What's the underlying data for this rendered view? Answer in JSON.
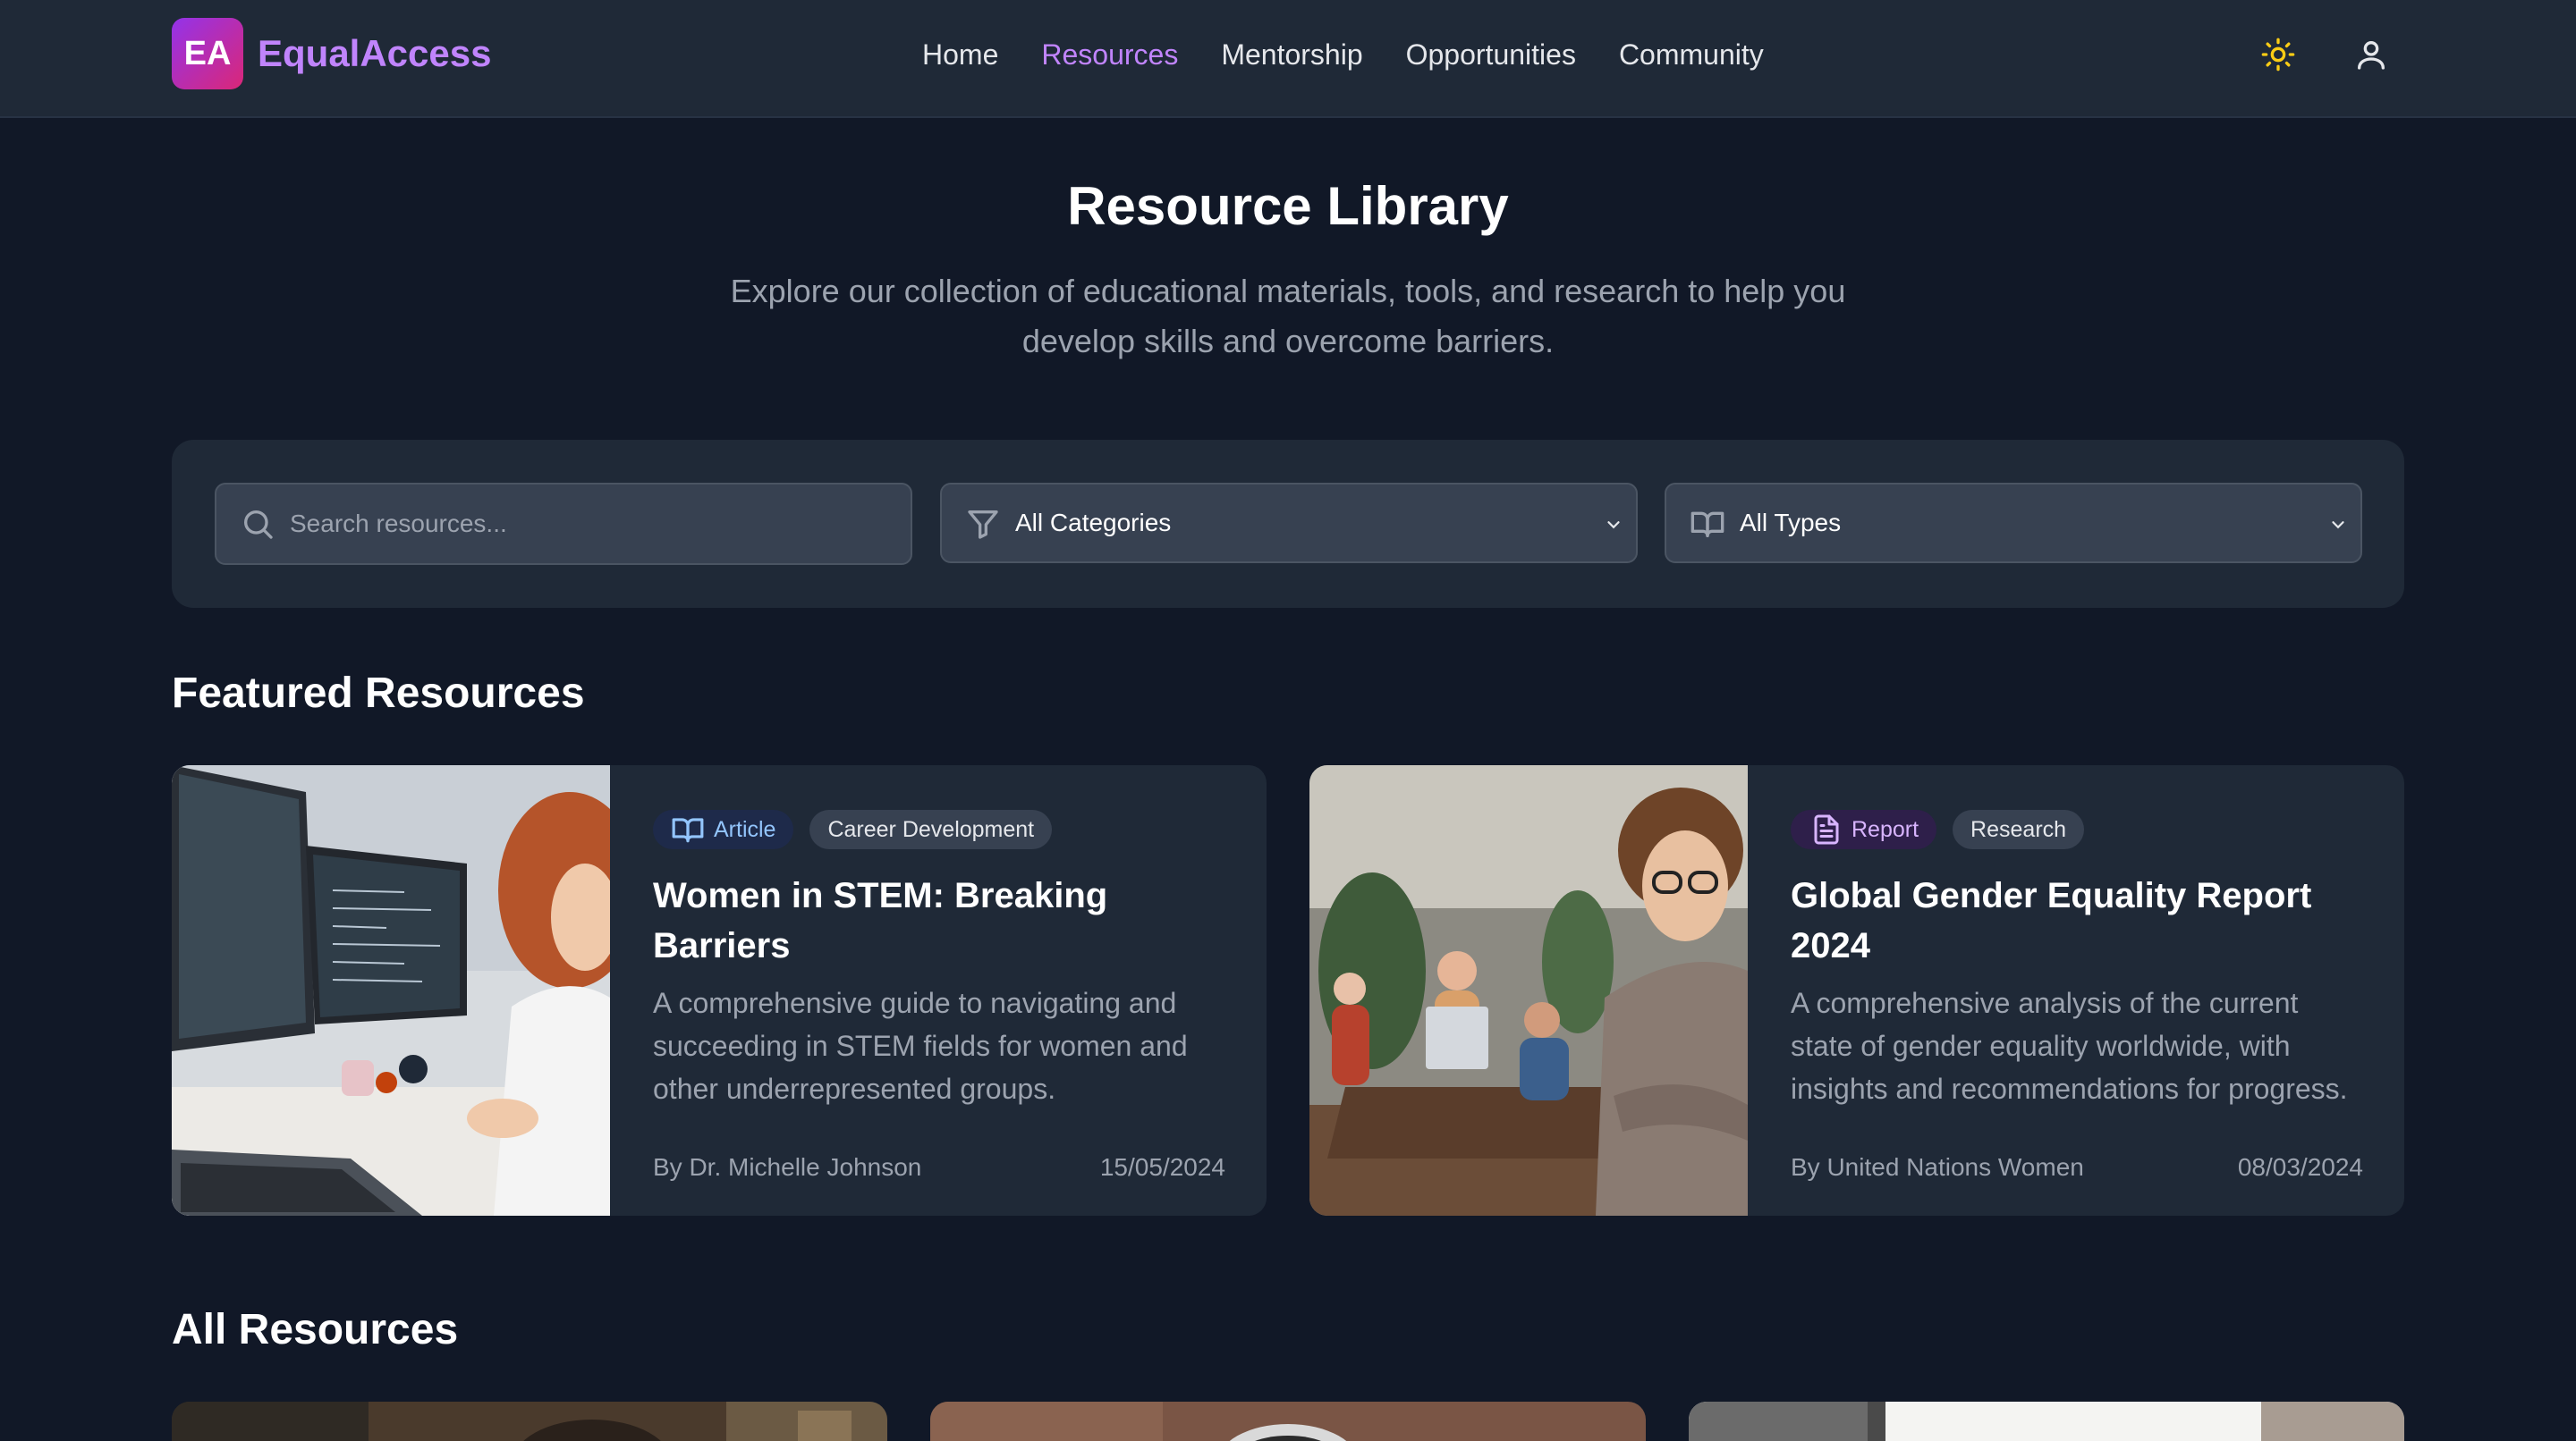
{
  "brand": {
    "logo_text": "EA",
    "name": "EqualAccess"
  },
  "nav": {
    "links": [
      {
        "label": "Home",
        "active": false
      },
      {
        "label": "Resources",
        "active": true
      },
      {
        "label": "Mentorship",
        "active": false
      },
      {
        "label": "Opportunities",
        "active": false
      },
      {
        "label": "Community",
        "active": false
      }
    ],
    "icons": {
      "theme": "sun-icon",
      "user": "user-icon"
    }
  },
  "hero": {
    "title": "Resource Library",
    "subtitle": "Explore our collection of educational materials, tools, and research to help you develop skills and overcome barriers."
  },
  "filters": {
    "search_placeholder": "Search resources...",
    "category_value": "All Categories",
    "type_value": "All Types"
  },
  "featured": {
    "heading": "Featured Resources",
    "cards": [
      {
        "type": "Article",
        "category": "Career Development",
        "title": "Women in STEM: Breaking Barriers",
        "description": "A comprehensive guide to navigating and succeeding in STEM fields for women and other underrepresented groups.",
        "author": "By Dr. Michelle Johnson",
        "date": "15/05/2024"
      },
      {
        "type": "Report",
        "category": "Research",
        "title": "Global Gender Equality Report 2024",
        "description": "A comprehensive analysis of the current state of gender equality worldwide, with insights and recommendations for progress.",
        "author": "By United Nations Women",
        "date": "08/03/2024"
      }
    ]
  },
  "all_resources": {
    "heading": "All Resources"
  },
  "colors": {
    "background": "#111827",
    "surface": "#1f2937",
    "accent": "#c084fc",
    "logo_gradient_start": "#9333ea",
    "logo_gradient_end": "#db2777",
    "sun": "#facc15"
  }
}
